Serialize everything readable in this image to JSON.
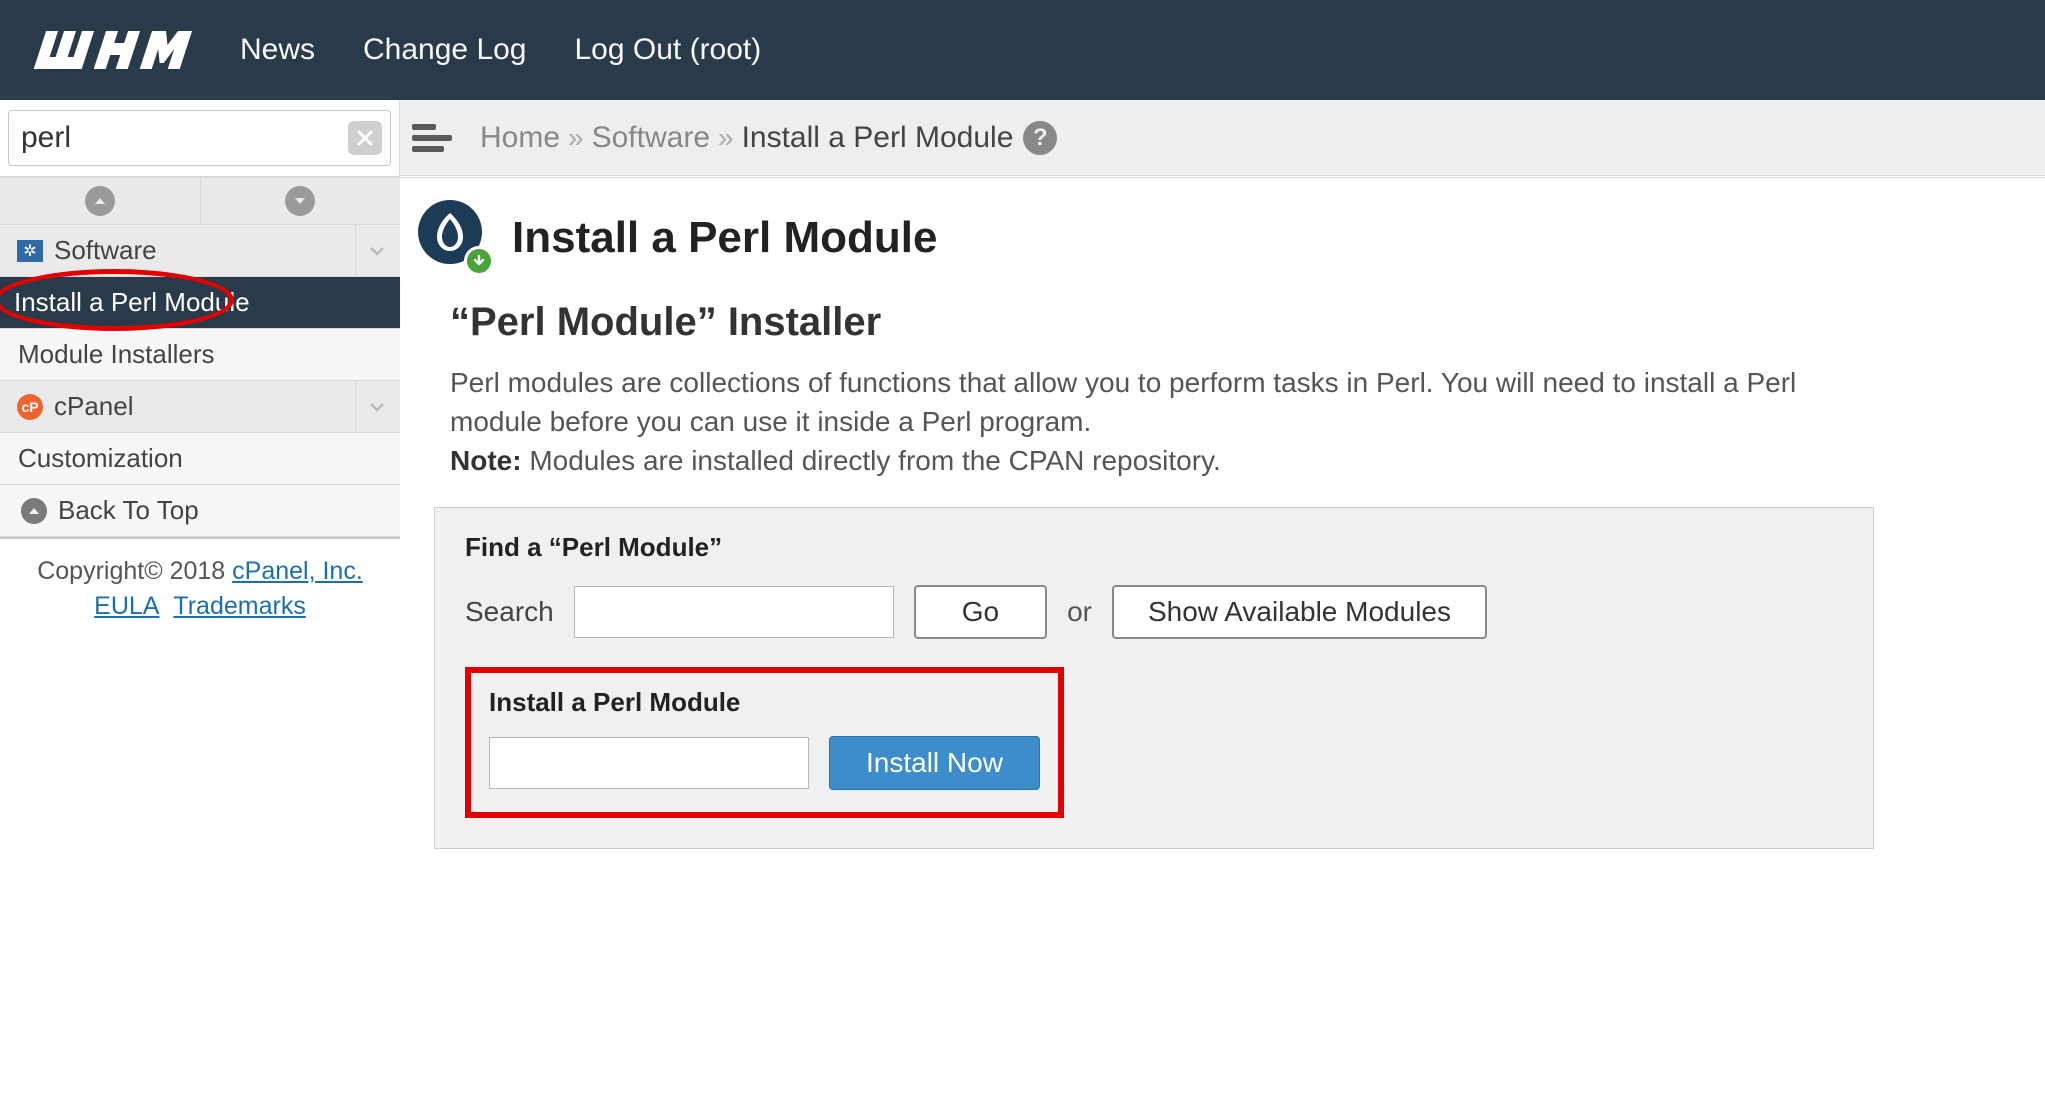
{
  "header": {
    "logo_text": "WHM",
    "links": {
      "news": "News",
      "changelog": "Change Log",
      "logout": "Log Out (root)"
    }
  },
  "search": {
    "value": "perl"
  },
  "breadcrumb": {
    "home": "Home",
    "section": "Software",
    "page": "Install a Perl Module"
  },
  "sidebar": {
    "software": {
      "label": "Software",
      "items": {
        "install_perl": "Install a Perl Module",
        "module_installers": "Module Installers"
      }
    },
    "cpanel": {
      "label": "cPanel",
      "items": {
        "customization": "Customization"
      }
    },
    "back_to_top": "Back To Top",
    "footer": {
      "copyright": "Copyright© 2018 ",
      "company": "cPanel, Inc.",
      "eula": "EULA",
      "trademarks": "Trademarks"
    }
  },
  "main": {
    "title": "Install a Perl Module",
    "subtitle": "“Perl Module” Installer",
    "desc1": "Perl modules are collections of functions that allow you to perform tasks in Perl. You will need to install a Perl module before you can use it inside a Perl program. ",
    "note_label": "Note:",
    "note_text": " Modules are installed directly from the CPAN repository.",
    "find_label": "Find a “Perl Module”",
    "search_label": "Search",
    "go_btn": "Go",
    "or": "or",
    "show_btn": "Show Available Modules",
    "install_title": "Install a Perl Module",
    "install_btn": "Install Now"
  }
}
